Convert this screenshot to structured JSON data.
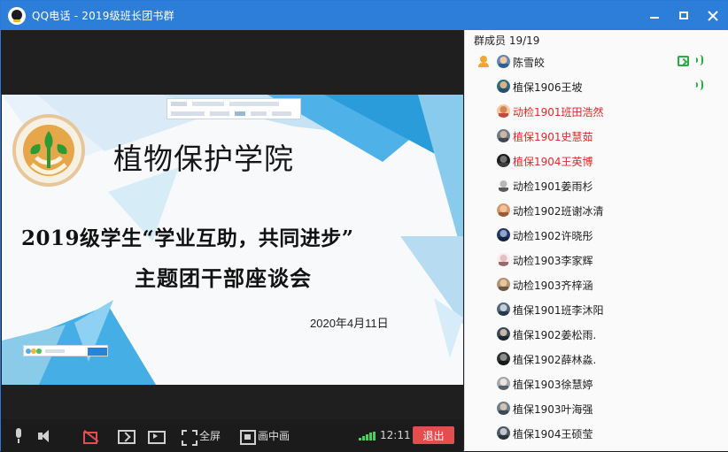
{
  "window": {
    "title": "QQ电话 - 2019级班长团书群",
    "app_icon": "qq-penguin-icon",
    "controls": [
      "minimize-icon",
      "maximize-icon",
      "close-icon"
    ]
  },
  "shared_slide": {
    "institution": "植物保护学院",
    "headline": "2019级学生“学业互助，共同进步”",
    "subheadline": "主题团干部座谈会",
    "date": "2020年4月11日",
    "logo_icon": "plant-leaf-logo-icon",
    "colors": {
      "background": "#f7f9fb",
      "blue_geometry": "#2b9cda",
      "logo_green": "#2c9a35",
      "logo_orange": "#e6a64a"
    }
  },
  "call_controls": {
    "fullscreen_label": "全屏",
    "pip_label": "画中画",
    "time": "12:11",
    "leave_label": "退出",
    "icons": [
      "microphone-icon",
      "speaker-icon",
      "camera-off-icon",
      "screen-share-icon",
      "video-share-icon",
      "fullscreen-icon",
      "picture-in-picture-icon",
      "signal-strength-icon"
    ],
    "colors": {
      "leave": "#e24d4d",
      "signal": "#3fd65a",
      "camera_off": "#e24d4d"
    }
  },
  "member_panel": {
    "header": "群成员 19/19",
    "members": [
      {
        "name": "陈雪皎",
        "red": false,
        "host": true,
        "sharing": true,
        "voice": true
      },
      {
        "name": "植保1906王坡",
        "red": false,
        "host": false,
        "sharing": false,
        "voice": true
      },
      {
        "name": "动检1901班田浩然",
        "red": true,
        "host": false,
        "sharing": false,
        "voice": false
      },
      {
        "name": "植保1901史慧茹",
        "red": true,
        "host": false,
        "sharing": false,
        "voice": false
      },
      {
        "name": "植保1904王英博",
        "red": true,
        "host": false,
        "sharing": false,
        "voice": false
      },
      {
        "name": "动检1901姜雨杉",
        "red": false,
        "host": false,
        "sharing": false,
        "voice": false
      },
      {
        "name": "动检1902班谢冰清",
        "red": false,
        "host": false,
        "sharing": false,
        "voice": false
      },
      {
        "name": "动检1902许晓彤",
        "red": false,
        "host": false,
        "sharing": false,
        "voice": false
      },
      {
        "name": "动检1903李家辉",
        "red": false,
        "host": false,
        "sharing": false,
        "voice": false
      },
      {
        "name": "动检1903齐梓涵",
        "red": false,
        "host": false,
        "sharing": false,
        "voice": false
      },
      {
        "name": "植保1901班李沐阳",
        "red": false,
        "host": false,
        "sharing": false,
        "voice": false
      },
      {
        "name": "植保1902姜松雨.",
        "red": false,
        "host": false,
        "sharing": false,
        "voice": false
      },
      {
        "name": "植保1902薛林淼.",
        "red": false,
        "host": false,
        "sharing": false,
        "voice": false
      },
      {
        "name": "植保1903徐慧婷",
        "red": false,
        "host": false,
        "sharing": false,
        "voice": false
      },
      {
        "name": "植保1903叶海强",
        "red": false,
        "host": false,
        "sharing": false,
        "voice": false
      },
      {
        "name": "植保1904王硕莹",
        "red": false,
        "host": false,
        "sharing": false,
        "voice": false
      }
    ],
    "colors": {
      "normal_name": "#202020",
      "highlight_name": "#e32727",
      "active": "#2aab43"
    }
  }
}
